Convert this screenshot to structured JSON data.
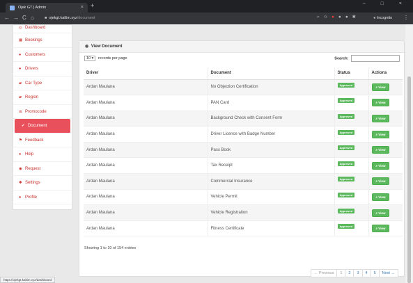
{
  "browser": {
    "tab_title": "Ojek GT | Admin",
    "tab_close": "×",
    "new_tab": "+",
    "window_controls": "–  □  ×",
    "url_host": "ojekgt.kaltim.xyz",
    "url_path": "/document",
    "incognito_label": "Incognito",
    "status_url": "https://ojekgt.kaltim.xyz/dashboard"
  },
  "sidebar": {
    "items": [
      {
        "label": "Dashboard",
        "icon": "dashboard-icon",
        "glyph": "◎"
      },
      {
        "label": "Bookings",
        "icon": "calendar-icon",
        "glyph": "▦"
      },
      {
        "label": "Customers",
        "icon": "user-icon",
        "glyph": "●"
      },
      {
        "label": "Drivers",
        "icon": "user-icon",
        "glyph": "●"
      },
      {
        "label": "Car Type",
        "icon": "car-icon",
        "glyph": "▰"
      },
      {
        "label": "Region",
        "icon": "car-icon",
        "glyph": "▰"
      },
      {
        "label": "Promocode",
        "icon": "list-icon",
        "glyph": "☰"
      },
      {
        "label": "Document",
        "icon": "check-icon",
        "glyph": "✔"
      },
      {
        "label": "Feedback",
        "icon": "flag-icon",
        "glyph": "⚑"
      },
      {
        "label": "Help",
        "icon": "user-icon",
        "glyph": "●"
      },
      {
        "label": "Request",
        "icon": "request-icon",
        "glyph": "◉"
      },
      {
        "label": "Settings",
        "icon": "gear-icon",
        "glyph": "✱"
      },
      {
        "label": "Profile",
        "icon": "user-icon",
        "glyph": "●"
      }
    ]
  },
  "panel": {
    "title": "View Document",
    "per_page_value": "10",
    "per_page_suffix": "records per page",
    "search_label": "Search:",
    "search_value": ""
  },
  "table": {
    "headers": [
      "Driver",
      "Document",
      "Status",
      "Actions"
    ],
    "rows": [
      {
        "driver": "Ardan Maulana",
        "document": "No Objection Certification",
        "status": "Approved",
        "action": "View"
      },
      {
        "driver": "Ardan Maulana",
        "document": "PAN Card",
        "status": "Approved",
        "action": "View"
      },
      {
        "driver": "Ardan Maulana",
        "document": "Background Check with Consent Form",
        "status": "Approved",
        "action": "View"
      },
      {
        "driver": "Ardan Maulana",
        "document": "Driver Licence with Badge Number",
        "status": "Approved",
        "action": "View"
      },
      {
        "driver": "Ardan Maulana",
        "document": "Pass Book",
        "status": "Approved",
        "action": "View"
      },
      {
        "driver": "Ardan Maulana",
        "document": "Tax Receipt",
        "status": "Approved",
        "action": "View"
      },
      {
        "driver": "Ardan Maulana",
        "document": "Commercial Insurance",
        "status": "Approved",
        "action": "View"
      },
      {
        "driver": "Ardan Maulana",
        "document": "Vehicle Permit",
        "status": "Approved",
        "action": "View"
      },
      {
        "driver": "Ardan Maulana",
        "document": "Vehicle Registration",
        "status": "Approved",
        "action": "View"
      },
      {
        "driver": "Ardan Maulana",
        "document": "Fitness Certificate",
        "status": "Approved",
        "action": "View"
      }
    ]
  },
  "info": "Showing 1 to 10 of 154 entries",
  "pagination": {
    "prev": "← Previous",
    "pages": [
      "1",
      "2",
      "3",
      "4",
      "5"
    ],
    "current": "1",
    "next": "Next →"
  },
  "colors": {
    "accent": "#e8505b",
    "sidebar_text": "#c9302c",
    "success": "#5cb85c"
  }
}
